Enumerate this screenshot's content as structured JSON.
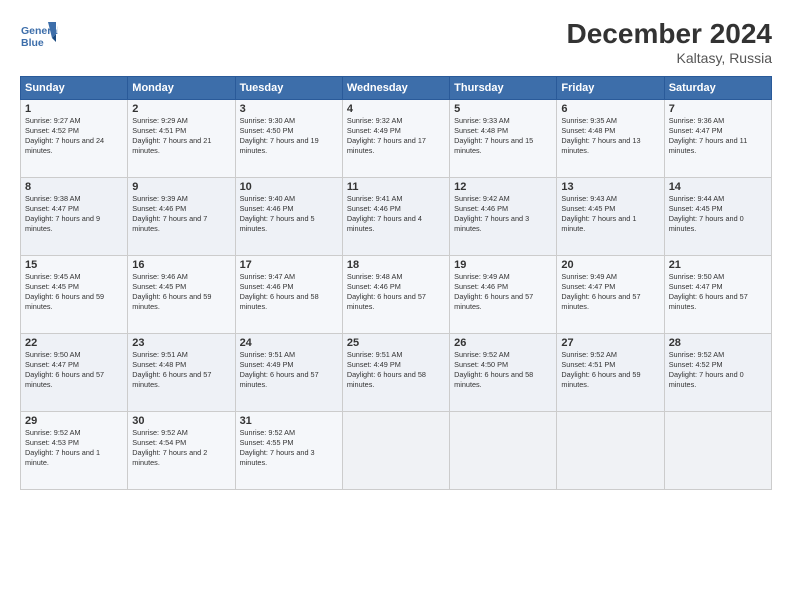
{
  "header": {
    "logo_line1": "General",
    "logo_line2": "Blue",
    "title": "December 2024",
    "subtitle": "Kaltasy, Russia"
  },
  "days_of_week": [
    "Sunday",
    "Monday",
    "Tuesday",
    "Wednesday",
    "Thursday",
    "Friday",
    "Saturday"
  ],
  "weeks": [
    [
      {
        "day": 1,
        "rise": "9:27 AM",
        "set": "4:52 PM",
        "daylight": "7 hours and 24 minutes."
      },
      {
        "day": 2,
        "rise": "9:29 AM",
        "set": "4:51 PM",
        "daylight": "7 hours and 21 minutes."
      },
      {
        "day": 3,
        "rise": "9:30 AM",
        "set": "4:50 PM",
        "daylight": "7 hours and 19 minutes."
      },
      {
        "day": 4,
        "rise": "9:32 AM",
        "set": "4:49 PM",
        "daylight": "7 hours and 17 minutes."
      },
      {
        "day": 5,
        "rise": "9:33 AM",
        "set": "4:48 PM",
        "daylight": "7 hours and 15 minutes."
      },
      {
        "day": 6,
        "rise": "9:35 AM",
        "set": "4:48 PM",
        "daylight": "7 hours and 13 minutes."
      },
      {
        "day": 7,
        "rise": "9:36 AM",
        "set": "4:47 PM",
        "daylight": "7 hours and 11 minutes."
      }
    ],
    [
      {
        "day": 8,
        "rise": "9:38 AM",
        "set": "4:47 PM",
        "daylight": "7 hours and 9 minutes."
      },
      {
        "day": 9,
        "rise": "9:39 AM",
        "set": "4:46 PM",
        "daylight": "7 hours and 7 minutes."
      },
      {
        "day": 10,
        "rise": "9:40 AM",
        "set": "4:46 PM",
        "daylight": "7 hours and 5 minutes."
      },
      {
        "day": 11,
        "rise": "9:41 AM",
        "set": "4:46 PM",
        "daylight": "7 hours and 4 minutes."
      },
      {
        "day": 12,
        "rise": "9:42 AM",
        "set": "4:46 PM",
        "daylight": "7 hours and 3 minutes."
      },
      {
        "day": 13,
        "rise": "9:43 AM",
        "set": "4:45 PM",
        "daylight": "7 hours and 1 minute."
      },
      {
        "day": 14,
        "rise": "9:44 AM",
        "set": "4:45 PM",
        "daylight": "7 hours and 0 minutes."
      }
    ],
    [
      {
        "day": 15,
        "rise": "9:45 AM",
        "set": "4:45 PM",
        "daylight": "6 hours and 59 minutes."
      },
      {
        "day": 16,
        "rise": "9:46 AM",
        "set": "4:45 PM",
        "daylight": "6 hours and 59 minutes."
      },
      {
        "day": 17,
        "rise": "9:47 AM",
        "set": "4:46 PM",
        "daylight": "6 hours and 58 minutes."
      },
      {
        "day": 18,
        "rise": "9:48 AM",
        "set": "4:46 PM",
        "daylight": "6 hours and 57 minutes."
      },
      {
        "day": 19,
        "rise": "9:49 AM",
        "set": "4:46 PM",
        "daylight": "6 hours and 57 minutes."
      },
      {
        "day": 20,
        "rise": "9:49 AM",
        "set": "4:47 PM",
        "daylight": "6 hours and 57 minutes."
      },
      {
        "day": 21,
        "rise": "9:50 AM",
        "set": "4:47 PM",
        "daylight": "6 hours and 57 minutes."
      }
    ],
    [
      {
        "day": 22,
        "rise": "9:50 AM",
        "set": "4:47 PM",
        "daylight": "6 hours and 57 minutes."
      },
      {
        "day": 23,
        "rise": "9:51 AM",
        "set": "4:48 PM",
        "daylight": "6 hours and 57 minutes."
      },
      {
        "day": 24,
        "rise": "9:51 AM",
        "set": "4:49 PM",
        "daylight": "6 hours and 57 minutes."
      },
      {
        "day": 25,
        "rise": "9:51 AM",
        "set": "4:49 PM",
        "daylight": "6 hours and 58 minutes."
      },
      {
        "day": 26,
        "rise": "9:52 AM",
        "set": "4:50 PM",
        "daylight": "6 hours and 58 minutes."
      },
      {
        "day": 27,
        "rise": "9:52 AM",
        "set": "4:51 PM",
        "daylight": "6 hours and 59 minutes."
      },
      {
        "day": 28,
        "rise": "9:52 AM",
        "set": "4:52 PM",
        "daylight": "7 hours and 0 minutes."
      }
    ],
    [
      {
        "day": 29,
        "rise": "9:52 AM",
        "set": "4:53 PM",
        "daylight": "7 hours and 1 minute."
      },
      {
        "day": 30,
        "rise": "9:52 AM",
        "set": "4:54 PM",
        "daylight": "7 hours and 2 minutes."
      },
      {
        "day": 31,
        "rise": "9:52 AM",
        "set": "4:55 PM",
        "daylight": "7 hours and 3 minutes."
      },
      null,
      null,
      null,
      null
    ]
  ]
}
